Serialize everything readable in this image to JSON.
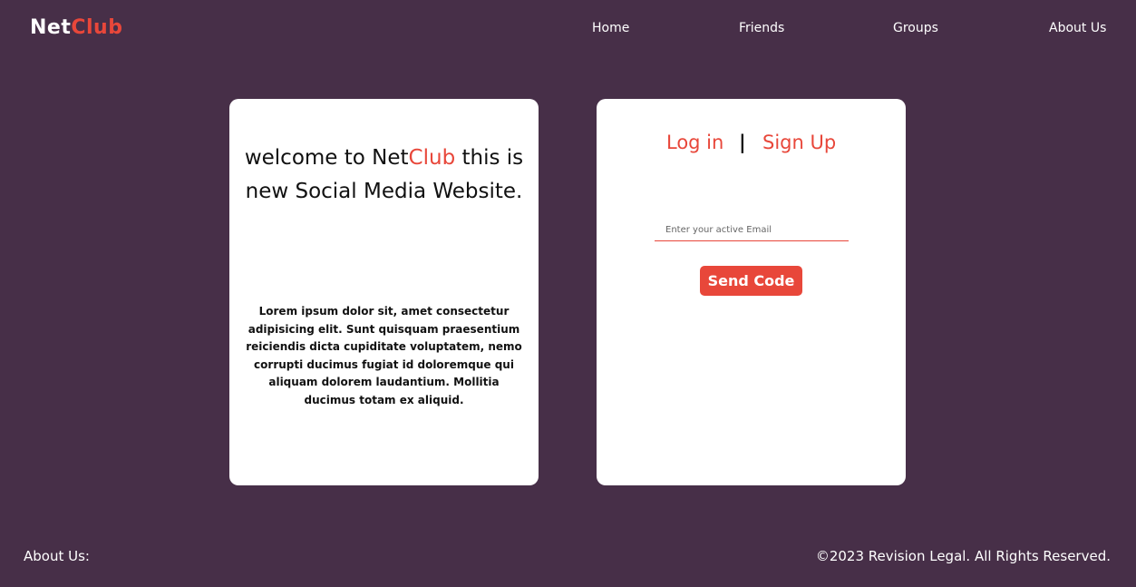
{
  "header": {
    "logo_part1": "Net",
    "logo_part2": "Club",
    "nav": {
      "home": "Home",
      "friends": "Friends",
      "groups": "Groups",
      "about": "About Us"
    }
  },
  "welcome": {
    "title_prefix": "welcome to ",
    "title_brand": "NetClub",
    "title_suffix": " this is new Social Media Website.",
    "body": "Lorem ipsum dolor sit, amet consectetur adipisicing elit. Sunt quisquam praesentium reiciendis dicta cupiditate voluptatem, nemo corrupti ducimus fugiat id doloremque qui aliquam dolorem laudantium. Mollitia ducimus totam ex aliquid."
  },
  "auth": {
    "login_label": "Log in",
    "separator": "|",
    "signup_label": "Sign Up",
    "email_placeholder": "Enter your active Email",
    "email_value": "",
    "send_label": "Send Code"
  },
  "footer": {
    "about_label": "About Us:",
    "copyright": "©2023 Revision Legal. All Rights Reserved."
  },
  "colors": {
    "background": "#472f48",
    "accent": "#e8473a",
    "card": "#ffffff"
  }
}
